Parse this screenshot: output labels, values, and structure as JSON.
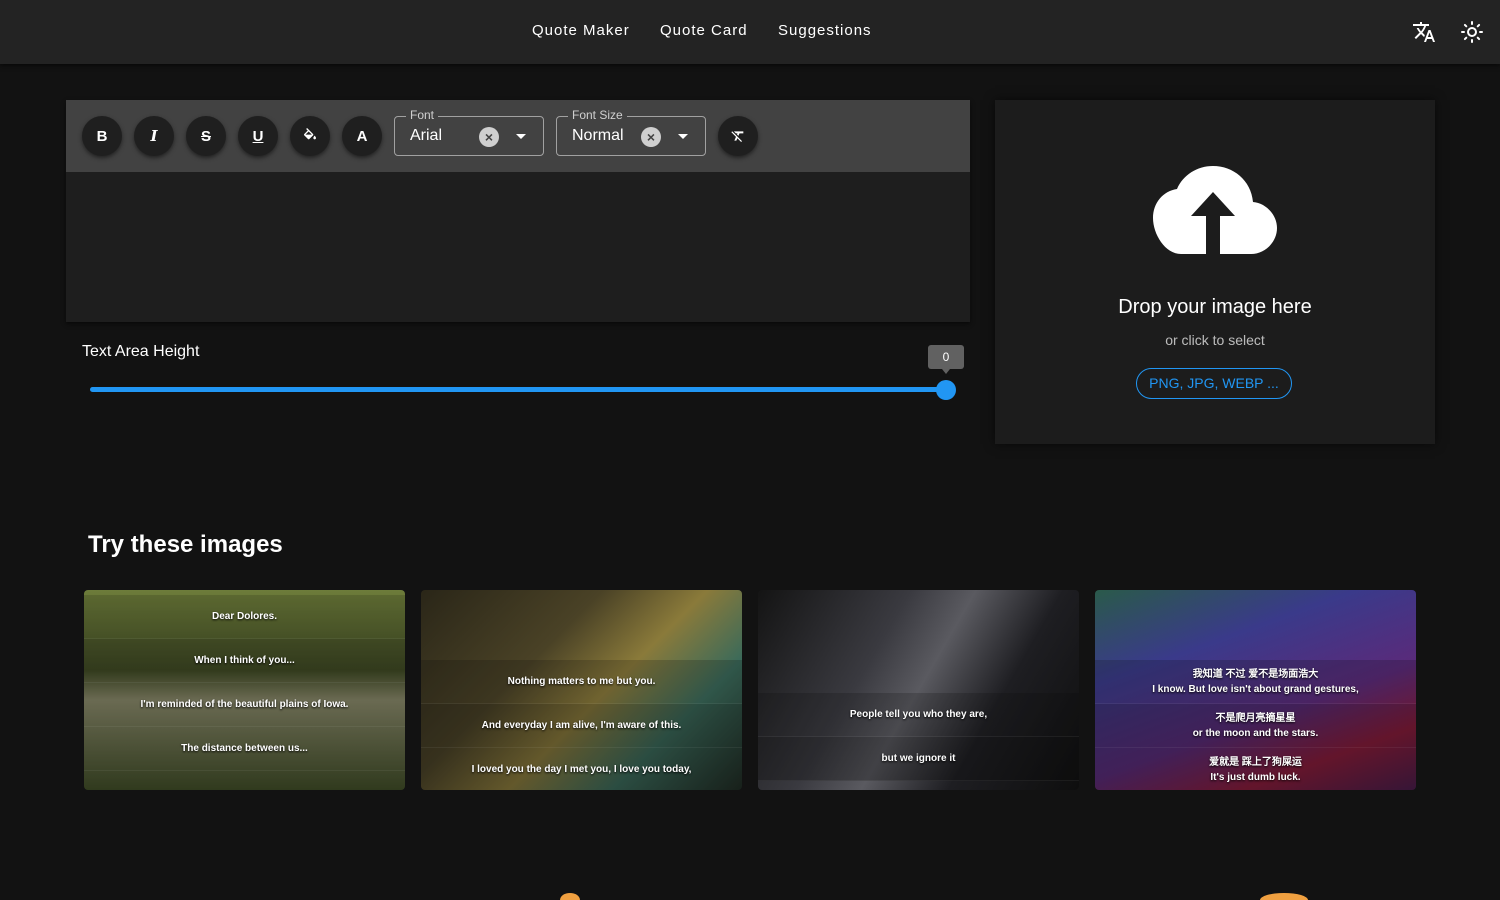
{
  "nav": {
    "items": [
      "Quote Maker",
      "Quote Card",
      "Suggestions"
    ],
    "translate_icon": "translate-icon",
    "theme_icon": "brightness-icon"
  },
  "editor": {
    "toolbar": {
      "bold": "B",
      "italic": "I",
      "strike": "S",
      "underline": "U",
      "fill_icon": "paint-bucket-icon",
      "text_color": "A",
      "clear_icon": "clear-format-icon"
    },
    "font": {
      "label": "Font",
      "value": "Arial"
    },
    "font_size": {
      "label": "Font Size",
      "value": "Normal"
    },
    "text_area": ""
  },
  "slider": {
    "label": "Text Area Height",
    "value": "0",
    "fill_fraction": 1.0
  },
  "dropzone": {
    "icon": "cloud-upload-icon",
    "title": "Drop your image here",
    "subtitle": "or click to select",
    "formats": "PNG, JPG, WEBP ..."
  },
  "gallery": {
    "title": "Try these images",
    "images": [
      {
        "lines": [
          [
            "Dear Dolores."
          ],
          [
            "When I think of you..."
          ],
          [
            "I'm reminded of the beautiful plains of Iowa."
          ],
          [
            "The distance between us..."
          ],
          [
            "..."
          ]
        ]
      },
      {
        "lines": [
          [
            ""
          ],
          [
            "Nothing matters to me but you."
          ],
          [
            "And everyday I am alive, I'm aware of this."
          ],
          [
            "I loved you the day I met you, I love you today,"
          ]
        ]
      },
      {
        "lines": [
          [
            ""
          ],
          [
            "People tell you who they are,"
          ],
          [
            "but we ignore it"
          ]
        ]
      },
      {
        "lines": [
          [
            ""
          ],
          [
            "我知道 不过 爱不是场面浩大",
            "I know. But love isn't about grand gestures,"
          ],
          [
            "不是爬月亮摘星星",
            "or the moon and the stars."
          ],
          [
            "爱就是 踩上了狗屎运",
            "It's just dumb luck."
          ]
        ]
      }
    ]
  },
  "colors": {
    "accent": "#2196f3",
    "background": "#121212",
    "appbar": "#232323",
    "toolbar": "#424242"
  }
}
